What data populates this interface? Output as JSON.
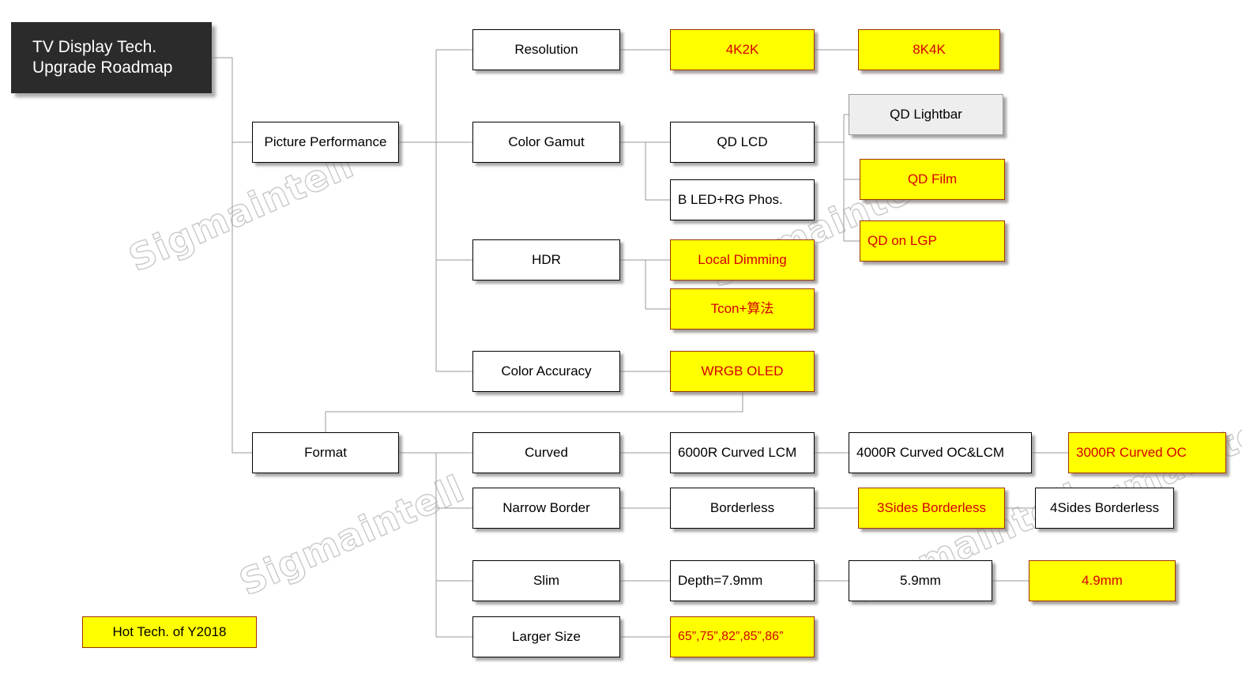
{
  "diagram": {
    "title_box": {
      "line1": "TV Display Tech.",
      "line2": "Upgrade Roadmap"
    },
    "legend": {
      "label": "Hot Tech. of Y2018"
    },
    "watermark_text": "Sigmaintell",
    "colors": {
      "highlight_fill": "#ffff00",
      "highlight_border": "#9c3300",
      "highlight_text": "#d40000",
      "title_fill": "#2b2b2b",
      "title_text": "#ffffff",
      "node_fill": "#ffffff",
      "node_border": "#000000",
      "grey_fill": "#eeeeee",
      "wire": "#9a9a9a",
      "watermark": "#c9c9c9"
    },
    "branches": {
      "picture_performance": "Picture Performance",
      "format": "Format"
    },
    "categories": {
      "resolution": "Resolution",
      "color_gamut": "Color Gamut",
      "hdr": "HDR",
      "color_accuracy": "Color Accuracy",
      "curved": "Curved",
      "narrow_border": "Narrow Border",
      "slim": "Slim",
      "larger_size": "Larger Size"
    },
    "nodes": {
      "res_4k2k": "4K2K",
      "res_8k4k": "8K4K",
      "qd_lcd": "QD LCD",
      "b_led_rg_phos": "B LED+RG Phos.",
      "qd_lightbar": "QD Lightbar",
      "qd_film": "QD Film",
      "qd_on_lgp": "QD on LGP",
      "local_dimming": "Local Dimming",
      "tcon_algo": "Tcon+算法",
      "wrgb_oled": "WRGB OLED",
      "curved_6000r": "6000R Curved LCM",
      "curved_4000r": "4000R Curved OC&LCM",
      "curved_3000r": "3000R Curved OC",
      "borderless": "Borderless",
      "borderless_3sides": "3Sides Borderless",
      "borderless_4sides": "4Sides Borderless",
      "depth_79": "Depth=7.9mm",
      "depth_59": "5.9mm",
      "depth_49": "4.9mm",
      "sizes": "65”,75”,82”,85”,86”"
    }
  }
}
